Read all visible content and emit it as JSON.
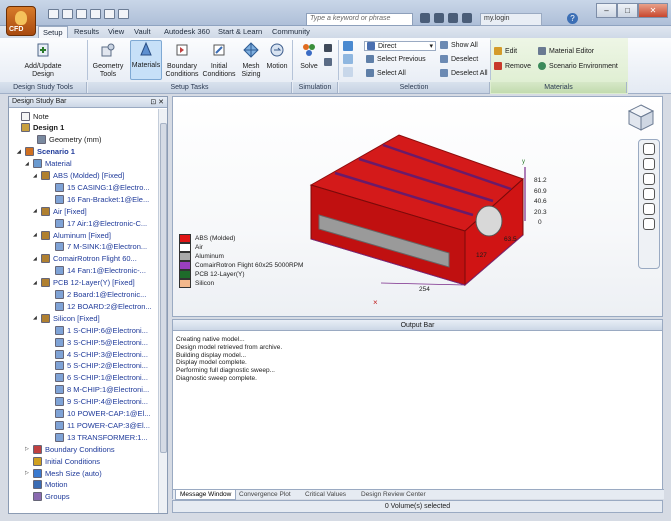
{
  "titlebar": {
    "search_placeholder": "Type a keyword or phrase",
    "login": "my.login",
    "help": "?",
    "minimize": "–",
    "maximize": "□",
    "close": "✕",
    "app_badge": "CFD"
  },
  "tabs": [
    "Setup",
    "Results",
    "View",
    "Vault",
    "Autodesk 360",
    "Start & Learn",
    "Community"
  ],
  "ribbon": {
    "design_tools": {
      "add_update": "Add/Update\nDesign",
      "group": "Design Study Tools"
    },
    "setup_tasks": {
      "buttons": [
        "Geometry\nTools",
        "Materials",
        "Boundary\nConditions",
        "Initial\nConditions",
        "Mesh\nSizing",
        "Motion"
      ],
      "group": "Setup Tasks"
    },
    "simulation": {
      "solve": "Solve",
      "group": "Simulation"
    },
    "selection": {
      "direct": "Direct",
      "select_previous": "Select Previous",
      "select_all": "Select All",
      "show_all": "Show All",
      "deselect": "Deselect",
      "deselect_all": "Deselect All",
      "group": "Selection"
    },
    "materials": {
      "edit": "Edit",
      "remove": "Remove",
      "material_editor": "Material Editor",
      "scenario_environment": "Scenario Environment",
      "group": "Materials"
    }
  },
  "left_panel": {
    "title": "Design Study Bar",
    "tree": [
      "Note",
      "Design 1",
      "Geometry (mm)",
      "Scenario 1",
      "Material",
      "ABS (Molded) [Fixed]",
      "15 CASING:1@Electro...",
      "16 Fan-Bracket:1@Ele...",
      "Air [Fixed]",
      "17 Air:1@Electronic-C...",
      "Aluminum [Fixed]",
      "7 M-SINK:1@Electron...",
      "ComairRotron Flight 60...",
      "14 Fan:1@Electronic-...",
      "PCB 12-Layer(Y) [Fixed]",
      "2 Board:1@Electronic...",
      "12 BOARD:2@Electron...",
      "Silicon [Fixed]",
      "1 S-CHIP:6@Electroni...",
      "3 S-CHIP:5@Electroni...",
      "4 S-CHIP:3@Electroni...",
      "5 S-CHIP:2@Electroni...",
      "6 S-CHIP:1@Electroni...",
      "8 M-CHIP:1@Electroni...",
      "9 S-CHIP:4@Electroni...",
      "10 POWER-CAP:1@El...",
      "11 POWER-CAP:3@El...",
      "13 TRANSFORMER:1...",
      "Boundary Conditions",
      "Initial Conditions",
      "Mesh Size (auto)",
      "Motion",
      "Groups"
    ]
  },
  "viewport": {
    "legend": [
      {
        "label": "ABS (Molded)",
        "color": "#e01515"
      },
      {
        "label": "Air",
        "color": "#ffffff"
      },
      {
        "label": "Aluminum",
        "color": "#a9a9a9"
      },
      {
        "label": "ComairRotron Flight 60x25 5000RPM",
        "color": "#9b3fbf"
      },
      {
        "label": "PCB 12-Layer(Y)",
        "color": "#1e6b2a"
      },
      {
        "label": "Silicon",
        "color": "#f3b88c"
      }
    ],
    "axis_ticks": [
      "81.2",
      "60.9",
      "40.6",
      "20.3",
      "0"
    ],
    "dims": {
      "depth": "63.5",
      "width": "127",
      "length": "254"
    }
  },
  "output_bar": {
    "title": "Output Bar",
    "lines": [
      "Creating native model...",
      "Design model retrieved from archive.",
      "Building display model...",
      "Display model complete.",
      "Performing full diagnostic sweep...",
      "Diagnostic sweep complete."
    ],
    "tabs": [
      "Message Window",
      "Convergence Plot",
      "Critical Values",
      "Design Review Center"
    ]
  },
  "status": "0 Volume(s) selected"
}
